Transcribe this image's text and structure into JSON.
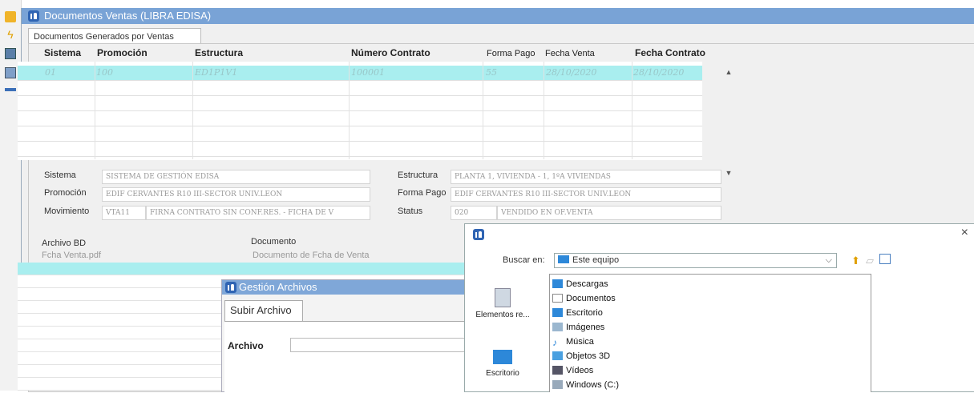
{
  "main_window": {
    "title": "Documentos Ventas (LIBRA EDISA)",
    "tab": "Documentos Generados por Ventas"
  },
  "grid": {
    "columns": [
      "Sistema",
      "Promoción",
      "Estructura",
      "Número Contrato",
      "Forma Pago",
      "Fecha Venta",
      "Fecha Contrato"
    ],
    "rows": [
      [
        "01",
        "100",
        "ED1P1V1",
        "100001",
        "55",
        "28/10/2020",
        "28/10/2020"
      ]
    ]
  },
  "form": {
    "sistema_label": "Sistema",
    "sistema_value": "SISTEMA DE GESTIÓN EDISA",
    "promocion_label": "Promoción",
    "promocion_value": "EDIF CERVANTES R10 III-SECTOR UNIV.LEON",
    "movimiento_label": "Movimiento",
    "movimiento_code": "VTA11",
    "movimiento_value": "FIRNA CONTRATO SIN CONF.RES. - FICHA DE V",
    "estructura_label": "Estructura",
    "estructura_value": "PLANTA 1, VIVIENDA - 1, 1ºA VIVIENDAS",
    "forma_pago_label": "Forma Pago",
    "forma_pago_value": "EDIF CERVANTES R10 III-SECTOR UNIV.LEON",
    "status_label": "Status",
    "status_code": "020",
    "status_value": "VENDIDO EN OF.VENTA"
  },
  "archivo": {
    "archivo_bd_label": "Archivo BD",
    "documento_label": "Documento",
    "archivo_bd_value": "Fcha Venta.pdf",
    "documento_value": "Documento de Fcha de Venta"
  },
  "gestion": {
    "title": "Gestión Archivos",
    "tab": "Subir Archivo",
    "archivo_label": "Archivo"
  },
  "dialog": {
    "close": "×",
    "buscar_label": "Buscar en:",
    "location": "Este equipo",
    "places": [
      "Elementos re...",
      "Escritorio"
    ],
    "items": [
      "Descargas",
      "Documentos",
      "Escritorio",
      "Imágenes",
      "Música",
      "Objetos 3D",
      "Vídeos",
      "Windows (C:)"
    ]
  },
  "colors": {
    "title_bar": "#79a3d6",
    "selected_row": "#a9eeef",
    "logo": "#2f64b3"
  }
}
